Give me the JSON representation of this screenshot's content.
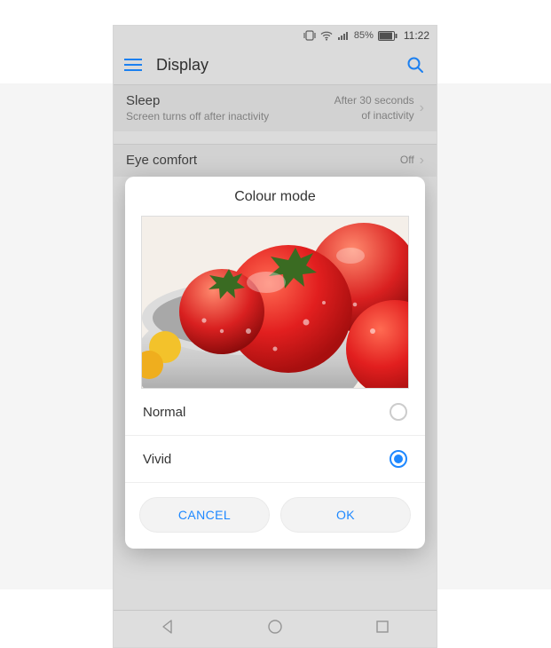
{
  "status": {
    "battery_pct": "85%",
    "time": "11:22"
  },
  "header": {
    "title": "Display"
  },
  "rows": {
    "sleep": {
      "title": "Sleep",
      "subtitle": "Screen turns off after inactivity",
      "value": "After 30 seconds of inactivity"
    },
    "eye": {
      "title": "Eye comfort",
      "value": "Off"
    }
  },
  "dialog": {
    "title": "Colour mode",
    "options": {
      "normal": "Normal",
      "vivid": "Vivid"
    },
    "selected": "vivid",
    "cancel": "CANCEL",
    "ok": "OK"
  }
}
